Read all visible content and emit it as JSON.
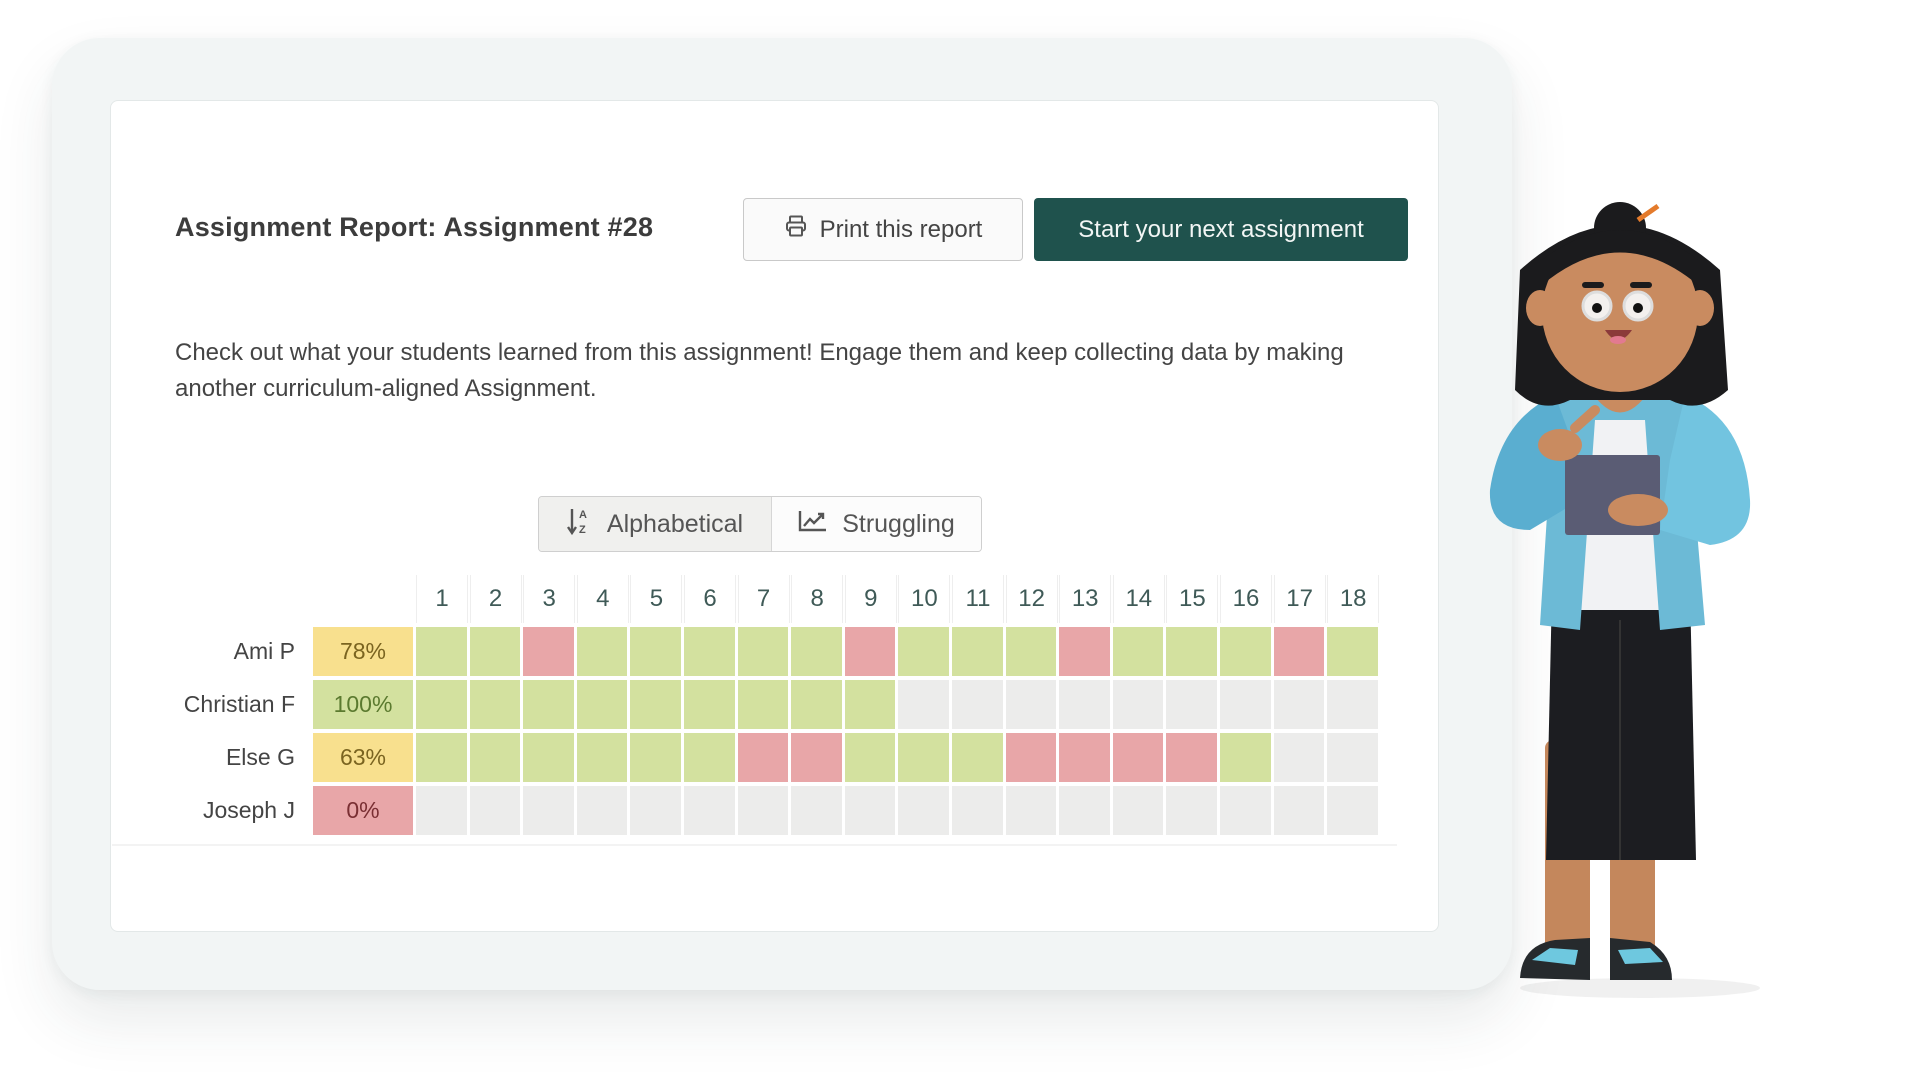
{
  "report": {
    "title": "Assignment Report: Assignment #28",
    "print_label": "Print this report",
    "start_label": "Start your next assignment",
    "description": "Check out what your students learned from this assignment! Engage them and keep collecting data by making another curriculum-aligned Assignment."
  },
  "sort": {
    "options": [
      {
        "label": "Alphabetical",
        "icon": "sort-alpha-icon",
        "active": true
      },
      {
        "label": "Struggling",
        "icon": "trend-chart-icon",
        "active": false
      }
    ]
  },
  "colors": {
    "correct": "#d3e19f",
    "incorrect": "#e8a6a8",
    "unanswered": "#ececeb",
    "score_high": "#d3e19f",
    "score_mid": "#f8e08e",
    "score_low": "#e8a6a8",
    "accent": "#1f524d"
  },
  "grid": {
    "questions": [
      "1",
      "2",
      "3",
      "4",
      "5",
      "6",
      "7",
      "8",
      "9",
      "10",
      "11",
      "12",
      "13",
      "14",
      "15",
      "16",
      "17",
      "18"
    ],
    "students": [
      {
        "name": "Ami P",
        "score": "78%",
        "level": "mid",
        "answers": [
          "c",
          "c",
          "x",
          "c",
          "c",
          "c",
          "c",
          "c",
          "x",
          "c",
          "c",
          "c",
          "x",
          "c",
          "c",
          "c",
          "x",
          "c"
        ]
      },
      {
        "name": "Christian F",
        "score": "100%",
        "level": "high",
        "answers": [
          "c",
          "c",
          "c",
          "c",
          "c",
          "c",
          "c",
          "c",
          "c",
          "n",
          "n",
          "n",
          "n",
          "n",
          "n",
          "n",
          "n",
          "n"
        ]
      },
      {
        "name": "Else G",
        "score": "63%",
        "level": "mid",
        "answers": [
          "c",
          "c",
          "c",
          "c",
          "c",
          "c",
          "x",
          "x",
          "c",
          "c",
          "c",
          "x",
          "x",
          "x",
          "x",
          "c",
          "n",
          "n"
        ]
      },
      {
        "name": "Joseph J",
        "score": "0%",
        "level": "low",
        "answers": [
          "n",
          "n",
          "n",
          "n",
          "n",
          "n",
          "n",
          "n",
          "n",
          "n",
          "n",
          "n",
          "n",
          "n",
          "n",
          "n",
          "n",
          "n"
        ]
      }
    ]
  },
  "illustration": {
    "description": "3D teacher character holding a tablet"
  }
}
